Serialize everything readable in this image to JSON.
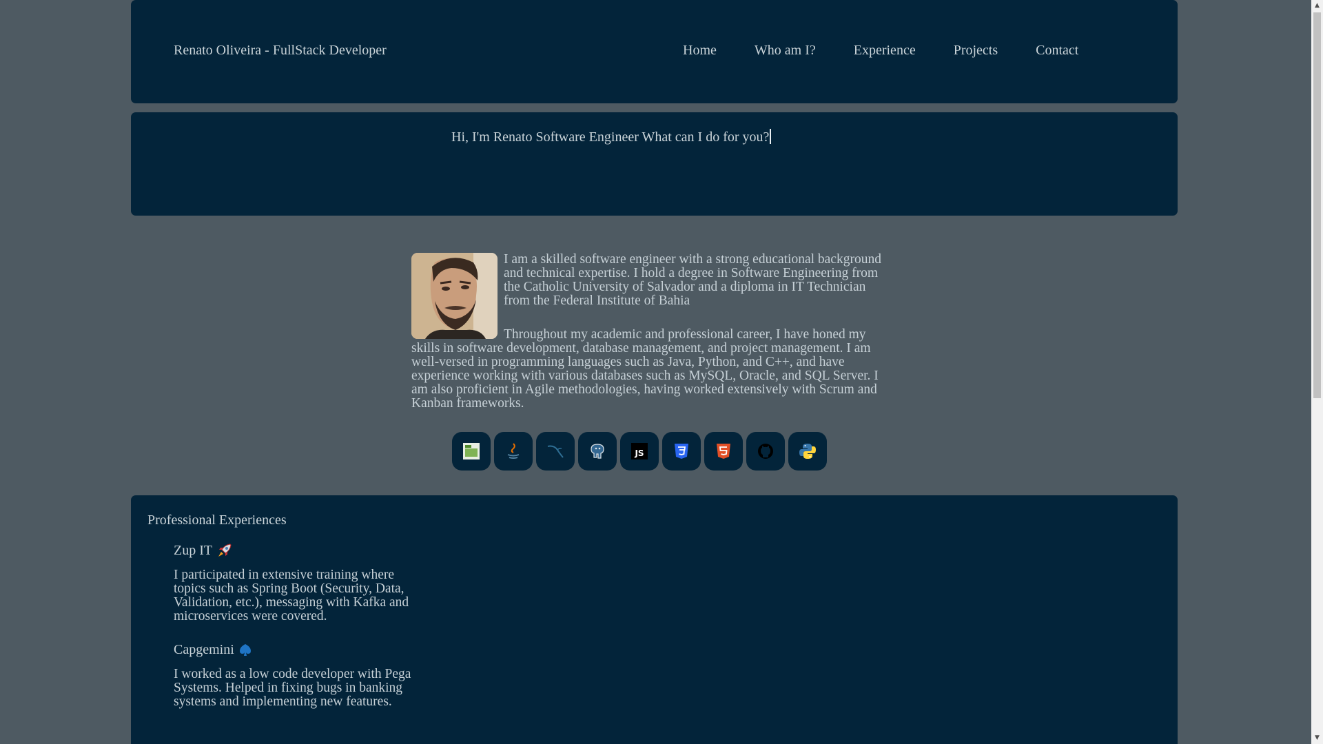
{
  "header": {
    "brand": "Renato Oliveira - FullStack Developer",
    "nav": [
      "Home",
      "Who am I?",
      "Experience",
      "Projects",
      "Contact"
    ]
  },
  "hero": {
    "typed_text": "Hi, I'm Renato Software Engineer What can I do for you?"
  },
  "about": {
    "paragraph1": "I am a skilled software engineer with a strong educational background and technical expertise. I hold a degree in Software Engineering from the Catholic University of Salvador and a diploma in IT Technician from the Federal Institute of Bahia",
    "paragraph2": "Throughout my academic and professional career, I have honed my skills in software development, database management, and project management. I am well-versed in programming languages such as Java, Python, and C++, and have experience working with various databases such as MySQL, Oracle, and SQL Server. I am also proficient in Agile methodologies, having worked extensively with Scrum and Kanban frameworks."
  },
  "skills": [
    {
      "icon": "spring-icon"
    },
    {
      "icon": "java-icon"
    },
    {
      "icon": "mysql-icon"
    },
    {
      "icon": "postgresql-icon"
    },
    {
      "icon": "javascript-icon"
    },
    {
      "icon": "css3-icon"
    },
    {
      "icon": "html5-icon"
    },
    {
      "icon": "github-icon"
    },
    {
      "icon": "python-icon"
    }
  ],
  "experience": {
    "title": "Professional Experiences",
    "jobs": [
      {
        "company": "Zup IT",
        "icon": "rocket-icon",
        "description": "I participated in extensive training where topics such as Spring Boot (Security, Data, Validation, etc.), messaging with Kafka and microservices were covered."
      },
      {
        "company": "Capgemini",
        "icon": "spade-icon",
        "description": "I worked as a low code developer with Pega Systems. Helped in fixing bugs in banking systems and implementing new features."
      }
    ]
  },
  "colors": {
    "background": "#4e5a62",
    "panel": "#03243a",
    "text": "#c9d3d8"
  }
}
